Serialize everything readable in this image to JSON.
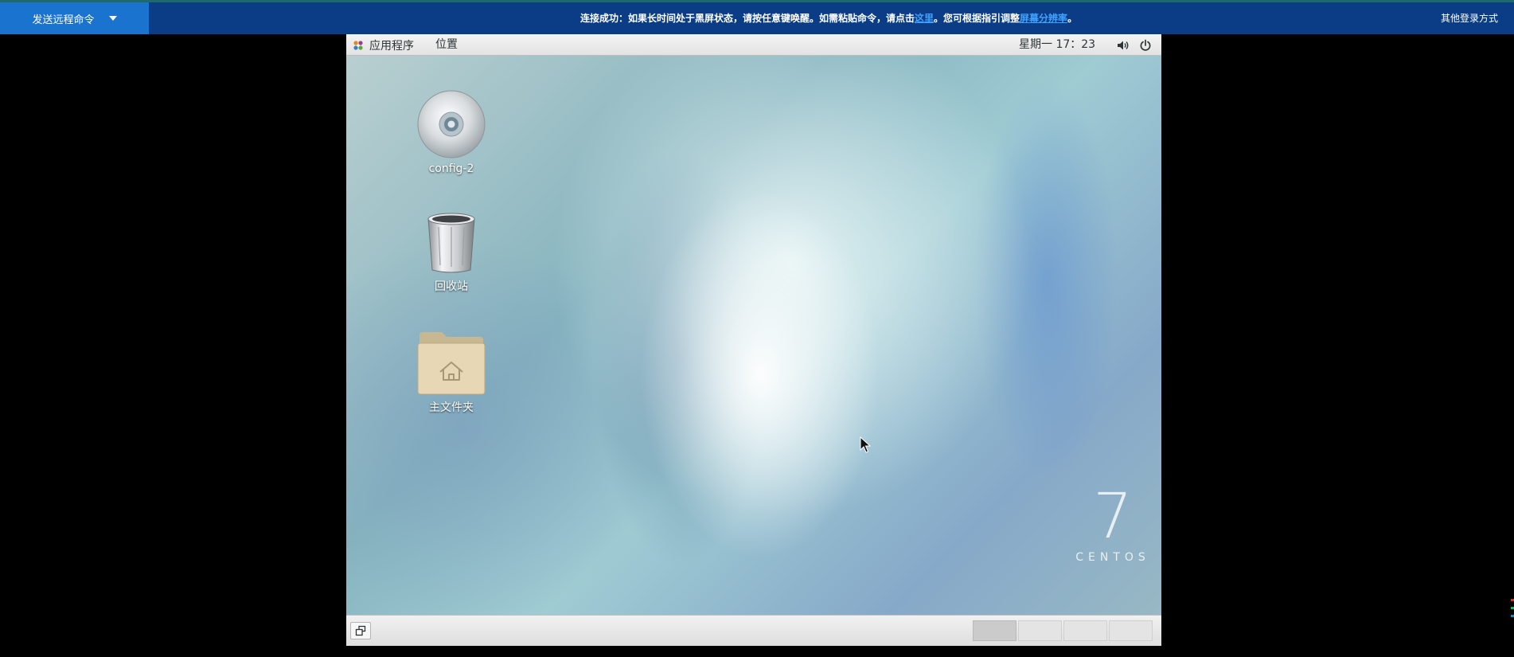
{
  "topbar": {
    "send_command_label": "发送远程命令",
    "notice_prefix": "连接成功：如果长时间处于黑屏状态，请按任意键唤醒。如需粘贴命令，请点击",
    "notice_link1": "这里",
    "notice_middle": "。您可根据指引调整",
    "notice_link2": "屏幕分辨率",
    "notice_suffix": "。",
    "other_login_label": "其他登录方式"
  },
  "panel": {
    "applications_label": "应用程序",
    "places_label": "位置",
    "clock": "星期一 17：23"
  },
  "desktop": {
    "icons": [
      {
        "label": "config-2",
        "icon": "disc-icon"
      },
      {
        "label": "回收站",
        "icon": "trash-icon"
      },
      {
        "label": "主文件夹",
        "icon": "home-folder-icon"
      }
    ],
    "logo_number": "7",
    "logo_text": "CENTOS"
  },
  "workspaces": {
    "count": 4,
    "active_index": 1
  },
  "colors": {
    "topbar_bg": "#0a3d86",
    "send_button_bg": "#1a73cf",
    "link": "#3fa1ff"
  }
}
